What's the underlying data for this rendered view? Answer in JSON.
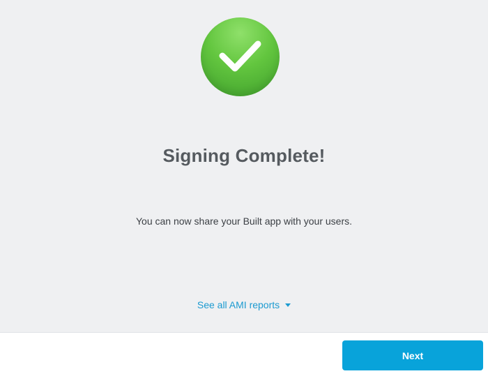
{
  "status": {
    "icon": "checkmark-icon",
    "title": "Signing Complete!",
    "message": "You can now share your Built app with your users."
  },
  "reports": {
    "link_label": "See all AMI reports",
    "caret_icon": "caret-down-icon"
  },
  "footer": {
    "next_label": "Next"
  },
  "colors": {
    "background": "#eff0f2",
    "success_green": "#63c63f",
    "link_blue": "#1b9ad0",
    "button_blue": "#08a3da"
  }
}
